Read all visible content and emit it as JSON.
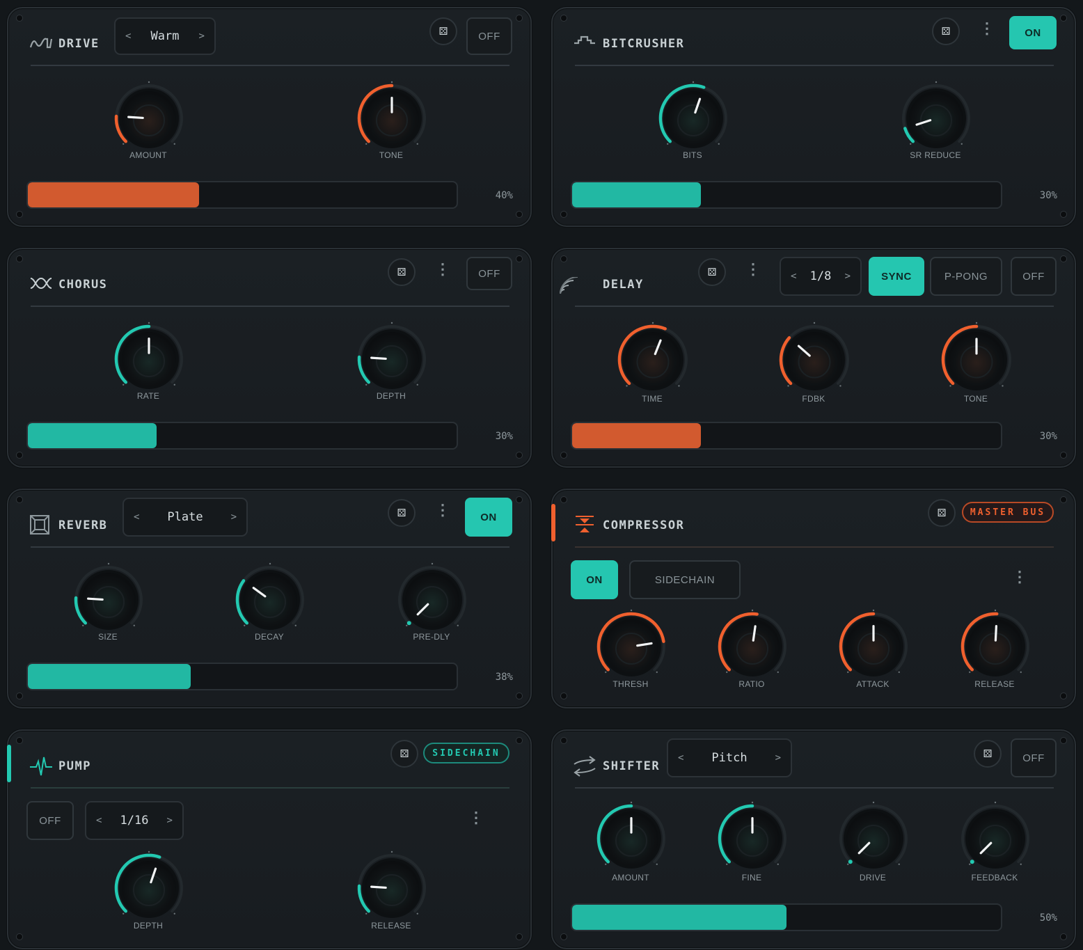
{
  "colors": {
    "orange": "#f0602e",
    "teal": "#23c9b1",
    "bar_orange": "#d25a2f",
    "bar_teal": "#22b8a3"
  },
  "drive": {
    "title": "DRIVE",
    "icon": "drive-wave-icon",
    "preset": {
      "prev": "<",
      "value": "Warm",
      "next": ">"
    },
    "power_label": "OFF",
    "knobs": [
      {
        "label": "AMOUNT",
        "value": 0.18
      },
      {
        "label": "TONE",
        "value": 0.5
      }
    ],
    "mix": 0.4,
    "mix_text": "40%"
  },
  "bitcrusher": {
    "title": "BITCRUSHER",
    "icon": "bitcrusher-step-icon",
    "power_label": "ON",
    "knobs": [
      {
        "label": "BITS",
        "value": 0.57
      },
      {
        "label": "SR REDUCE",
        "value": 0.1
      }
    ],
    "mix": 0.3,
    "mix_text": "30%"
  },
  "chorus": {
    "title": "CHORUS",
    "icon": "chorus-wave-icon",
    "power_label": "OFF",
    "knobs": [
      {
        "label": "RATE",
        "value": 0.5
      },
      {
        "label": "DEPTH",
        "value": 0.18
      }
    ],
    "mix": 0.3,
    "mix_text": "30%"
  },
  "delay": {
    "title": "DELAY",
    "icon": "delay-signal-icon",
    "division": {
      "prev": "<",
      "value": "1/8",
      "next": ">"
    },
    "sync_label": "SYNC",
    "pingpong_label": "P-PONG",
    "power_label": "OFF",
    "knobs": [
      {
        "label": "TIME",
        "value": 0.58
      },
      {
        "label": "FDBK",
        "value": 0.32
      },
      {
        "label": "TONE",
        "value": 0.5
      }
    ],
    "mix": 0.3,
    "mix_text": "30%"
  },
  "reverb": {
    "title": "REVERB",
    "icon": "reverb-room-icon",
    "preset": {
      "prev": "<",
      "value": "Plate",
      "next": ">"
    },
    "power_label": "ON",
    "knobs": [
      {
        "label": "SIZE",
        "value": 0.18
      },
      {
        "label": "DECAY",
        "value": 0.3
      },
      {
        "label": "PRE-DLY",
        "value": 0.0
      }
    ],
    "mix": 0.38,
    "mix_text": "38%"
  },
  "compressor": {
    "title": "COMPRESSOR",
    "icon": "compress-arrows-icon",
    "tag": "MASTER BUS",
    "power_label": "ON",
    "sidechain_label": "SIDECHAIN",
    "knobs": [
      {
        "label": "THRESH",
        "value": 0.8
      },
      {
        "label": "RATIO",
        "value": 0.53
      },
      {
        "label": "ATTACK",
        "value": 0.5
      },
      {
        "label": "RELEASE",
        "value": 0.51
      }
    ]
  },
  "pump": {
    "title": "PUMP",
    "icon": "pulse-icon",
    "tag": "SIDECHAIN",
    "power_label": "OFF",
    "division": {
      "prev": "<",
      "value": "1/16",
      "next": ">"
    },
    "knobs": [
      {
        "label": "DEPTH",
        "value": 0.57
      },
      {
        "label": "RELEASE",
        "value": 0.18
      }
    ]
  },
  "shifter": {
    "title": "SHIFTER",
    "icon": "shift-arrows-icon",
    "preset": {
      "prev": "<",
      "value": "Pitch",
      "next": ">"
    },
    "power_label": "OFF",
    "knobs": [
      {
        "label": "AMOUNT",
        "value": 0.5
      },
      {
        "label": "FINE",
        "value": 0.5
      },
      {
        "label": "DRIVE",
        "value": 0.0
      },
      {
        "label": "FEEDBACK",
        "value": 0.0
      }
    ],
    "mix": 0.5,
    "mix_text": "50%"
  }
}
